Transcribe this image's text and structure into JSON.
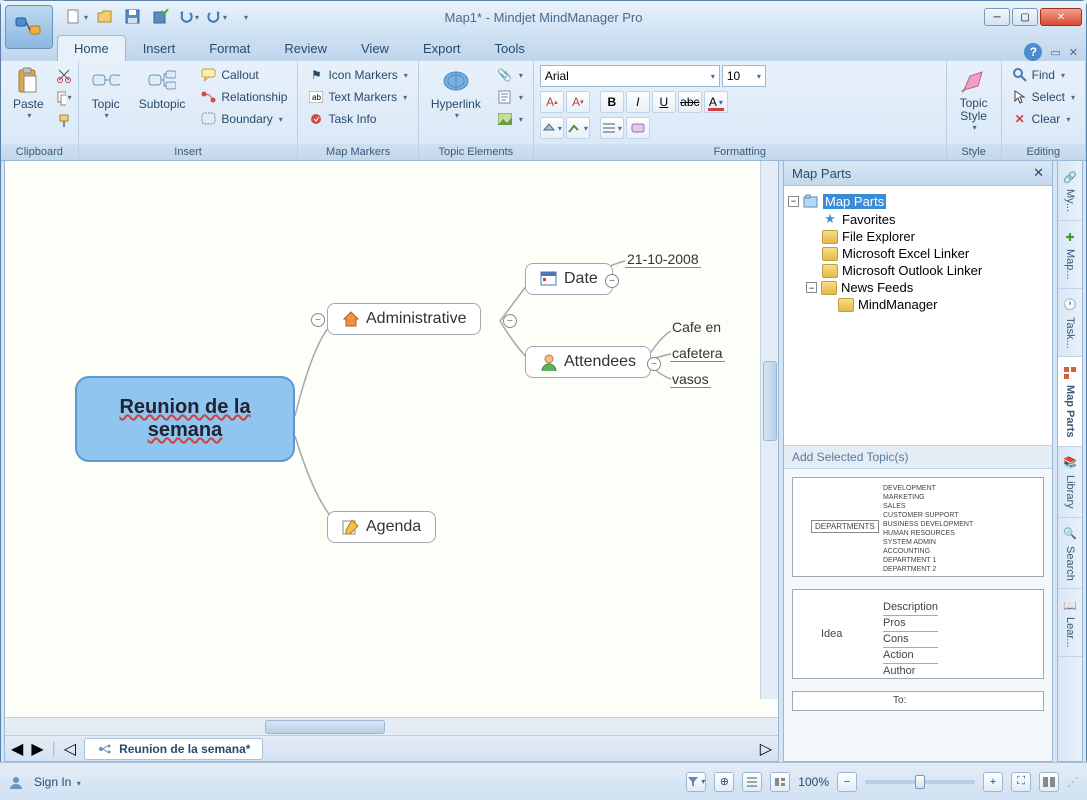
{
  "title": "Map1* - Mindjet MindManager Pro",
  "tabs": {
    "home": "Home",
    "insert": "Insert",
    "format": "Format",
    "review": "Review",
    "view": "View",
    "export": "Export",
    "tools": "Tools"
  },
  "ribbon": {
    "clipboard": {
      "paste": "Paste",
      "label": "Clipboard"
    },
    "insert": {
      "topic": "Topic",
      "subtopic": "Subtopic",
      "callout": "Callout",
      "relationship": "Relationship",
      "boundary": "Boundary",
      "label": "Insert"
    },
    "markers": {
      "icon": "Icon Markers",
      "text": "Text Markers",
      "task": "Task Info",
      "label": "Map Markers"
    },
    "elements": {
      "hyperlink": "Hyperlink",
      "label": "Topic Elements"
    },
    "formatting": {
      "font": "Arial",
      "size": "10",
      "label": "Formatting"
    },
    "style": {
      "topicstyle": "Topic\nStyle",
      "label": "Style"
    },
    "editing": {
      "find": "Find",
      "select": "Select",
      "clear": "Clear",
      "label": "Editing"
    }
  },
  "map": {
    "central": "Reunion de la semana",
    "administrative": "Administrative",
    "agenda": "Agenda",
    "date": "Date",
    "date_val": "21-10-2008",
    "attendees": "Attendees",
    "att1": "Cafe en",
    "att2": "cafetera",
    "att3": "vasos"
  },
  "doctab": "Reunion de la semana*",
  "panel": {
    "title": "Map Parts",
    "root": "Map Parts",
    "favorites": "Favorites",
    "file_explorer": "File Explorer",
    "excel_linker": "Microsoft Excel Linker",
    "outlook_linker": "Microsoft Outlook Linker",
    "news_feeds": "News Feeds",
    "mindmanager": "MindManager",
    "subheader": "Add Selected Topic(s)"
  },
  "preview1": {
    "root": "DEPARTMENTS",
    "items": [
      "DEVELOPMENT",
      "MARKETING",
      "SALES",
      "CUSTOMER SUPPORT",
      "BUSINESS DEVELOPMENT",
      "HUMAN RESOURCES",
      "SYSTEM ADMIN",
      "ACCOUNTING",
      "DEPARTMENT 1",
      "DEPARTMENT 2"
    ]
  },
  "preview2": {
    "root": "Idea",
    "items": [
      "Description",
      "Pros",
      "Cons",
      "Action",
      "Author"
    ]
  },
  "preview3": {
    "to": "To:"
  },
  "sidetabs": {
    "my": "My...",
    "map": "Map...",
    "task": "Task...",
    "mapparts": "Map Parts",
    "library": "Library",
    "search": "Search",
    "lear": "Lear..."
  },
  "status": {
    "signin": "Sign In",
    "zoom": "100%"
  }
}
